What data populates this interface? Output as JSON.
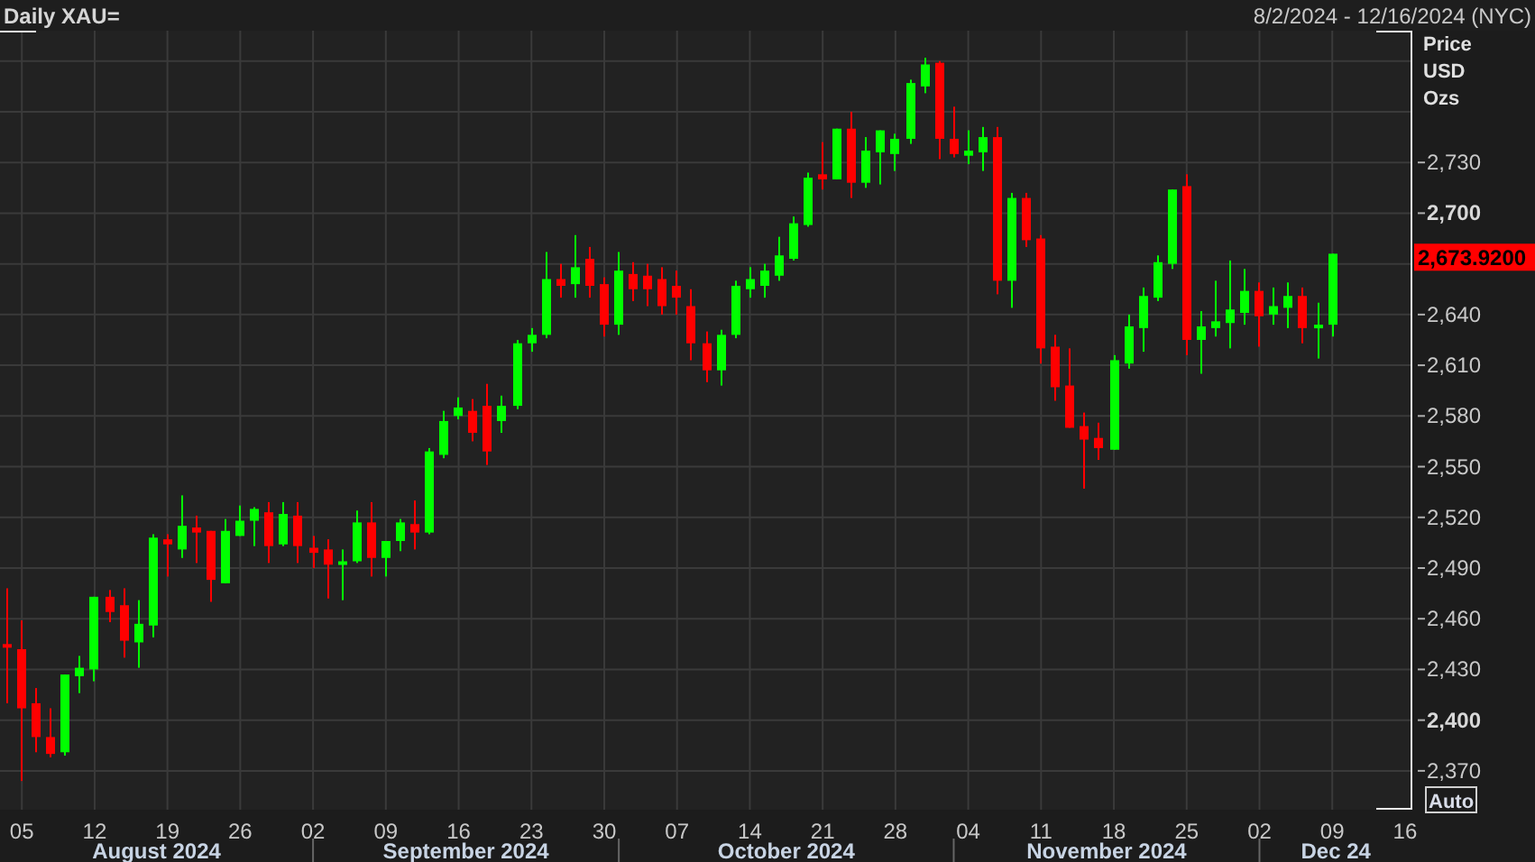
{
  "header": {
    "title": "Daily XAU=",
    "date_range": "8/2/2024 - 12/16/2024 (NYC)"
  },
  "chart": {
    "y_axis_units": [
      "Price",
      "USD",
      "Ozs"
    ],
    "last_price": "2,673.9200",
    "auto_button": "Auto",
    "months": [
      "August 2024",
      "September 2024",
      "October 2024",
      "November 2024",
      "Dec 24"
    ],
    "chart_data": {
      "type": "candlestick",
      "categories": [
        null,
        "05",
        null,
        null,
        null,
        null,
        "12",
        null,
        null,
        null,
        null,
        "19",
        null,
        null,
        null,
        null,
        "26",
        null,
        null,
        null,
        null,
        "02",
        null,
        null,
        null,
        null,
        "09",
        null,
        null,
        null,
        null,
        "16",
        null,
        null,
        null,
        null,
        "23",
        null,
        null,
        null,
        null,
        "30",
        null,
        null,
        null,
        null,
        "07",
        null,
        null,
        null,
        null,
        "14",
        null,
        null,
        null,
        null,
        "21",
        null,
        null,
        null,
        null,
        "28",
        null,
        null,
        null,
        null,
        "04",
        null,
        null,
        null,
        null,
        "11",
        null,
        null,
        null,
        null,
        "18",
        null,
        null,
        null,
        null,
        "25",
        null,
        null,
        null,
        null,
        "02",
        null,
        null,
        null,
        null,
        "09",
        null,
        null,
        null,
        null,
        "16"
      ],
      "ohlc": [
        [
          2445,
          2478,
          2410,
          2443
        ],
        [
          2442,
          2459,
          2364,
          2407
        ],
        [
          2410,
          2419,
          2381,
          2390
        ],
        [
          2390,
          2407,
          2378,
          2380
        ],
        [
          2381,
          2427,
          2379,
          2427
        ],
        [
          2426,
          2438,
          2416,
          2431
        ],
        [
          2430,
          2473,
          2423,
          2473
        ],
        [
          2473,
          2477,
          2458,
          2464
        ],
        [
          2468,
          2478,
          2437,
          2447
        ],
        [
          2446,
          2471,
          2431,
          2457
        ],
        [
          2456,
          2510,
          2449,
          2508
        ],
        [
          2507,
          2510,
          2485,
          2504
        ],
        [
          2501,
          2533,
          2496,
          2515
        ],
        [
          2514,
          2521,
          2493,
          2511
        ],
        [
          2512,
          2512,
          2470,
          2483
        ],
        [
          2481,
          2519,
          2481,
          2512
        ],
        [
          2509,
          2527,
          2509,
          2518
        ],
        [
          2518,
          2526,
          2503,
          2525
        ],
        [
          2523,
          2529,
          2493,
          2503
        ],
        [
          2504,
          2529,
          2503,
          2522
        ],
        [
          2521,
          2529,
          2493,
          2503
        ],
        [
          2502,
          2509,
          2490,
          2499
        ],
        [
          2501,
          2507,
          2472,
          2492
        ],
        [
          2492,
          2501,
          2471,
          2494
        ],
        [
          2494,
          2524,
          2493,
          2517
        ],
        [
          2517,
          2529,
          2485,
          2496
        ],
        [
          2496,
          2506,
          2485,
          2506
        ],
        [
          2506,
          2519,
          2500,
          2517
        ],
        [
          2516,
          2530,
          2501,
          2511
        ],
        [
          2511,
          2561,
          2510,
          2559
        ],
        [
          2557,
          2583,
          2555,
          2577
        ],
        [
          2580,
          2591,
          2578,
          2585
        ],
        [
          2583,
          2590,
          2565,
          2570
        ],
        [
          2586,
          2599,
          2551,
          2559
        ],
        [
          2577,
          2592,
          2570,
          2586
        ],
        [
          2586,
          2625,
          2584,
          2623
        ],
        [
          2623,
          2632,
          2618,
          2628
        ],
        [
          2628,
          2677,
          2626,
          2661
        ],
        [
          2661,
          2670,
          2650,
          2657
        ],
        [
          2658,
          2687,
          2650,
          2668
        ],
        [
          2673,
          2680,
          2650,
          2657
        ],
        [
          2658,
          2662,
          2627,
          2634
        ],
        [
          2634,
          2677,
          2628,
          2666
        ],
        [
          2664,
          2671,
          2648,
          2655
        ],
        [
          2663,
          2670,
          2645,
          2655
        ],
        [
          2661,
          2668,
          2640,
          2645
        ],
        [
          2657,
          2666,
          2640,
          2650
        ],
        [
          2645,
          2655,
          2613,
          2623
        ],
        [
          2623,
          2630,
          2600,
          2607
        ],
        [
          2607,
          2631,
          2598,
          2628
        ],
        [
          2628,
          2660,
          2626,
          2657
        ],
        [
          2655,
          2668,
          2650,
          2661
        ],
        [
          2657,
          2670,
          2650,
          2666
        ],
        [
          2663,
          2686,
          2660,
          2675
        ],
        [
          2673,
          2698,
          2672,
          2694
        ],
        [
          2693,
          2724,
          2692,
          2721
        ],
        [
          2723,
          2742,
          2714,
          2720
        ],
        [
          2720,
          2750,
          2720,
          2750
        ],
        [
          2750,
          2760,
          2709,
          2718
        ],
        [
          2718,
          2745,
          2715,
          2737
        ],
        [
          2736,
          2749,
          2717,
          2749
        ],
        [
          2735,
          2747,
          2725,
          2744
        ],
        [
          2744,
          2779,
          2741,
          2777
        ],
        [
          2775,
          2792,
          2771,
          2788
        ],
        [
          2789,
          2790,
          2732,
          2744
        ],
        [
          2744,
          2763,
          2733,
          2735
        ],
        [
          2734,
          2749,
          2729,
          2737
        ],
        [
          2736,
          2751,
          2725,
          2745
        ],
        [
          2745,
          2751,
          2652,
          2660
        ],
        [
          2660,
          2712,
          2644,
          2709
        ],
        [
          2709,
          2712,
          2680,
          2684
        ],
        [
          2685,
          2687,
          2611,
          2620
        ],
        [
          2621,
          2628,
          2589,
          2597
        ],
        [
          2598,
          2620,
          2573,
          2573
        ],
        [
          2574,
          2582,
          2537,
          2566
        ],
        [
          2567,
          2576,
          2554,
          2561
        ],
        [
          2560,
          2616,
          2560,
          2613
        ],
        [
          2611,
          2640,
          2608,
          2633
        ],
        [
          2632,
          2656,
          2618,
          2651
        ],
        [
          2650,
          2675,
          2648,
          2671
        ],
        [
          2670,
          2714,
          2667,
          2714
        ],
        [
          2716,
          2723,
          2616,
          2625
        ],
        [
          2625,
          2642,
          2605,
          2633
        ],
        [
          2632,
          2660,
          2627,
          2636
        ],
        [
          2635,
          2672,
          2620,
          2643
        ],
        [
          2641,
          2667,
          2634,
          2654
        ],
        [
          2654,
          2659,
          2621,
          2639
        ],
        [
          2640,
          2656,
          2634,
          2645
        ],
        [
          2644,
          2659,
          2632,
          2651
        ],
        [
          2651,
          2656,
          2623,
          2632
        ],
        [
          2632,
          2647,
          2614,
          2634
        ],
        [
          2634,
          2676,
          2627,
          2676
        ],
        null,
        null,
        null,
        null,
        null
      ],
      "ylim": [
        2347,
        2808
      ],
      "grid": true,
      "yticks": [
        {
          "value": 2370,
          "label": "2,370"
        },
        {
          "value": 2400,
          "label": "2,400"
        },
        {
          "value": 2430,
          "label": "2,430"
        },
        {
          "value": 2460,
          "label": "2,460"
        },
        {
          "value": 2490,
          "label": "2,490"
        },
        {
          "value": 2520,
          "label": "2,520"
        },
        {
          "value": 2550,
          "label": "2,550"
        },
        {
          "value": 2580,
          "label": "2,580"
        },
        {
          "value": 2610,
          "label": "2,610"
        },
        {
          "value": 2640,
          "label": "2,640"
        },
        {
          "value": 2700,
          "label": "2,700"
        },
        {
          "value": 2730,
          "label": "2,730"
        }
      ]
    }
  }
}
